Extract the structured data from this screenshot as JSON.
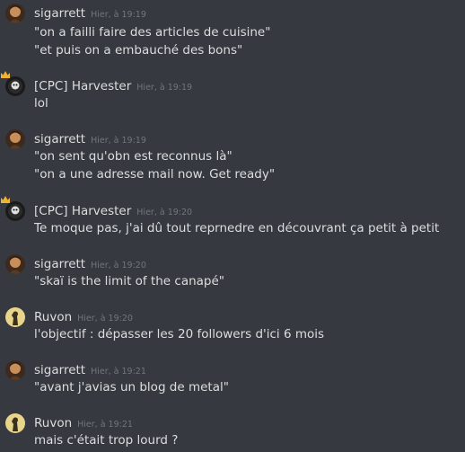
{
  "messages": [
    {
      "author": "sigarrett",
      "timestamp": "Hier, à 19:19",
      "avatar": "sigarrett-avatar",
      "lines": [
        "\"on a failli faire des articles de cuisine\"",
        "\"et puis on a embauché des bons\""
      ]
    },
    {
      "author": "[CPC] Harvester",
      "timestamp": "Hier, à 19:19",
      "avatar": "harvester-avatar",
      "lines": [
        "lol"
      ]
    },
    {
      "author": "sigarrett",
      "timestamp": "Hier, à 19:19",
      "avatar": "sigarrett-avatar",
      "lines": [
        "\"on sent qu'obn est reconnus là\"",
        "\"on a une adresse mail now. Get ready\""
      ]
    },
    {
      "author": "[CPC] Harvester",
      "timestamp": "Hier, à 19:20",
      "avatar": "harvester-avatar",
      "lines": [
        "Te moque pas, j'ai dû tout reprnedre en découvrant ça petit à petit"
      ]
    },
    {
      "author": "sigarrett",
      "timestamp": "Hier, à 19:20",
      "avatar": "sigarrett-avatar",
      "lines": [
        "\"skaï is the limit of the canapé\""
      ]
    },
    {
      "author": "Ruvon",
      "timestamp": "Hier, à 19:20",
      "avatar": "ruvon-avatar",
      "lines": [
        "l'objectif : dépasser les 20 followers d'ici 6 mois"
      ]
    },
    {
      "author": "sigarrett",
      "timestamp": "Hier, à 19:21",
      "avatar": "sigarrett-avatar",
      "lines": [
        "\"avant j'avias un blog de metal\""
      ]
    },
    {
      "author": "Ruvon",
      "timestamp": "Hier, à 19:21",
      "avatar": "ruvon-avatar",
      "lines": [
        "mais c'était trop lourd ?"
      ]
    }
  ],
  "colors": {
    "background": "#36393f",
    "text": "#dcddde",
    "timestamp": "#72767d",
    "crown": "#f0b232"
  }
}
